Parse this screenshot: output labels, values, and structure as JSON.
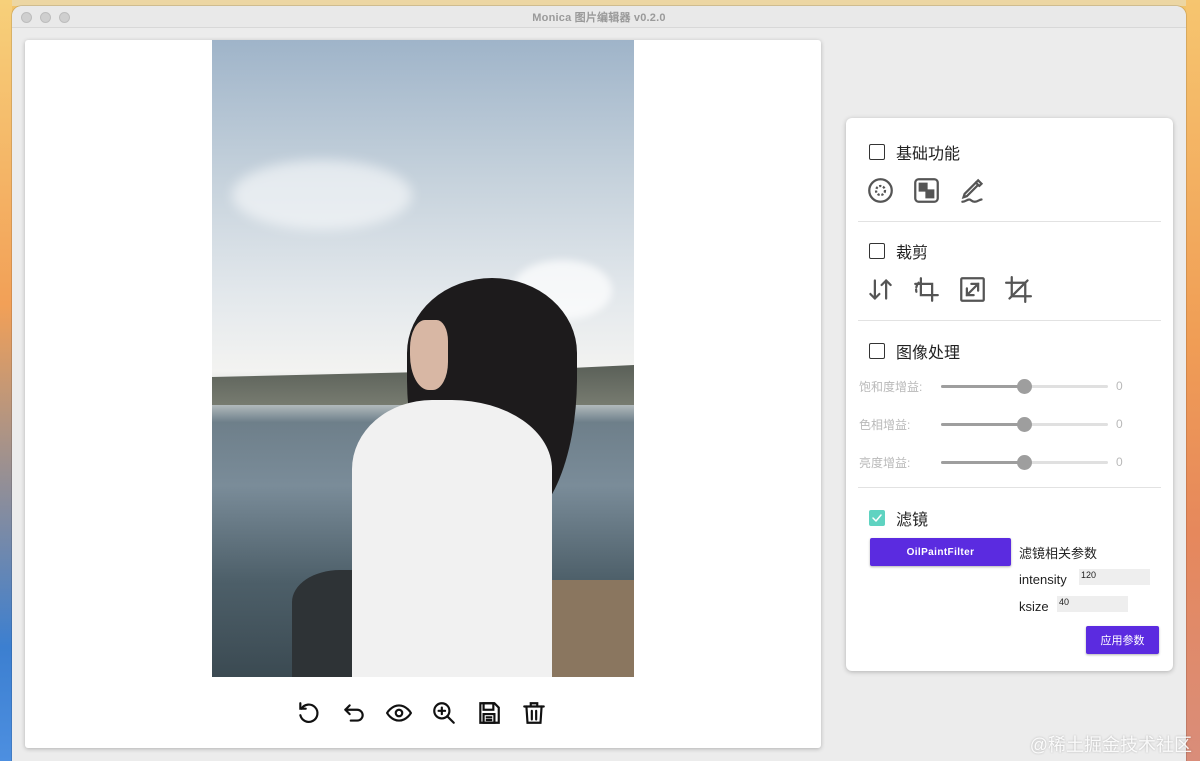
{
  "window": {
    "title": "Monica 图片编辑器 v0.2.0"
  },
  "toolbar": {
    "items": [
      {
        "name": "rotate",
        "icon": "rotate-icon"
      },
      {
        "name": "undo",
        "icon": "undo-icon"
      },
      {
        "name": "preview",
        "icon": "eye-icon"
      },
      {
        "name": "zoom",
        "icon": "zoom-in-icon"
      },
      {
        "name": "save",
        "icon": "save-icon"
      },
      {
        "name": "delete",
        "icon": "trash-icon"
      }
    ]
  },
  "panel": {
    "basic": {
      "label": "基础功能",
      "checked": false,
      "icons": [
        "color-picker-icon",
        "mosaic-icon",
        "draw-icon"
      ]
    },
    "crop": {
      "label": "裁剪",
      "checked": false,
      "icons": [
        "flip-icon",
        "rotate-crop-icon",
        "resize-icon",
        "crop-icon"
      ]
    },
    "image_processing": {
      "label": "图像处理",
      "checked": false,
      "sliders": [
        {
          "label": "饱和度增益:",
          "value": "0",
          "level": 0.5
        },
        {
          "label": "色相增益:",
          "value": "0",
          "level": 0.5
        },
        {
          "label": "亮度增益:",
          "value": "0",
          "level": 0.5
        }
      ]
    },
    "filter": {
      "label": "滤镜",
      "checked": true,
      "button_label": "OilPaintFilter",
      "params_title": "滤镜相关参数",
      "intensity_label": "intensity",
      "intensity_value": "120",
      "ksize_label": "ksize",
      "ksize_value": "40",
      "apply_label": "应用参数"
    }
  },
  "watermark": "@稀土掘金技术社区",
  "colors": {
    "accent": "#5b2be0",
    "checkbox_checked": "#5fd3c1"
  }
}
